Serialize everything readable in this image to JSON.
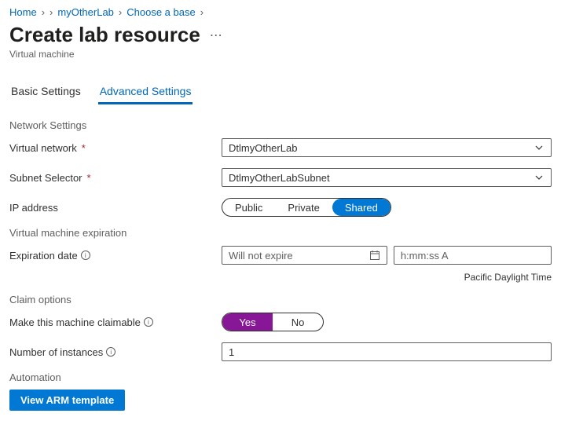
{
  "breadcrumb": {
    "home": "Home",
    "lab": "myOtherLab",
    "choose": "Choose a base"
  },
  "page": {
    "title": "Create lab resource",
    "subtitle": "Virtual machine"
  },
  "tabs": {
    "basic": "Basic Settings",
    "advanced": "Advanced Settings"
  },
  "sections": {
    "network": "Network Settings",
    "expiration": "Virtual machine expiration",
    "claim": "Claim options",
    "automation": "Automation"
  },
  "fields": {
    "vnet_label": "Virtual network",
    "vnet_value": "DtlmyOtherLab",
    "subnet_label": "Subnet Selector",
    "subnet_value": "DtlmyOtherLabSubnet",
    "ip_label": "IP address",
    "ip_public": "Public",
    "ip_private": "Private",
    "ip_shared": "Shared",
    "expdate_label": "Expiration date",
    "expdate_value": "Will not expire",
    "exptime_placeholder": "h:mm:ss A",
    "timezone": "Pacific Daylight Time",
    "claim_label": "Make this machine claimable",
    "claim_yes": "Yes",
    "claim_no": "No",
    "instances_label": "Number of instances",
    "instances_value": "1",
    "arm_button": "View ARM template"
  }
}
